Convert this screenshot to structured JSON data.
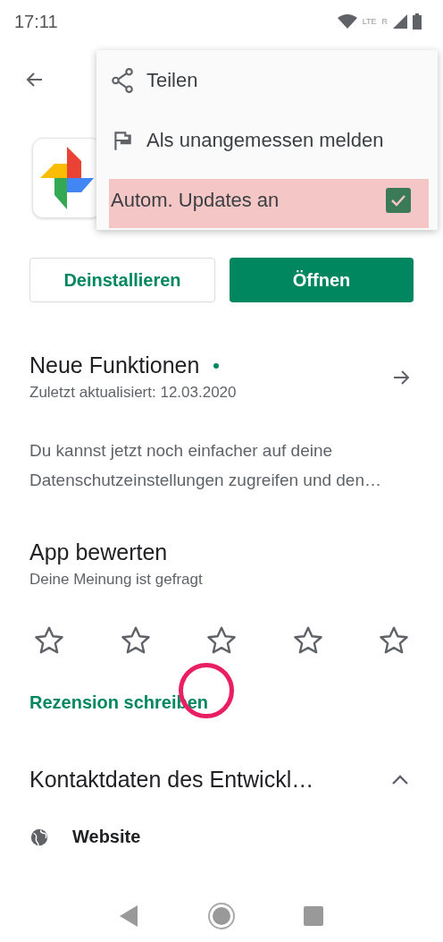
{
  "status_bar": {
    "time": "17:11",
    "network": "LTE",
    "roaming": "R"
  },
  "menu": {
    "items": [
      {
        "kind": "share",
        "label": "Teilen"
      },
      {
        "kind": "flag",
        "label": "Als unangemessen melden"
      },
      {
        "kind": "checkbox",
        "label": "Autom. Updates an",
        "checked": true,
        "highlighted": true
      }
    ]
  },
  "actions": {
    "uninstall": "Deinstallieren",
    "open": "Öffnen"
  },
  "whats_new": {
    "title": "Neue Funktionen",
    "new": true,
    "updated": "Zuletzt aktualisiert: 12.03.2020",
    "text": "Du kannst jetzt noch einfacher auf deine Datenschutzeinstellungen zugreifen und den…"
  },
  "rate": {
    "title": "App bewerten",
    "subtitle": "Deine Meinung ist gefragt",
    "stars": 0,
    "write_review": "Rezension schreiben"
  },
  "contact": {
    "title": "Kontaktdaten des Entwickl…",
    "expanded": true,
    "items": [
      {
        "label": "Website"
      }
    ]
  }
}
